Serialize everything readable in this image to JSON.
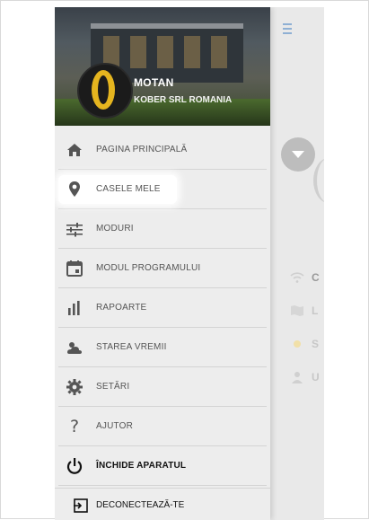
{
  "drawer": {
    "brand": "MOTAN",
    "company": "KOBER SRL ROMANIA",
    "items": [
      {
        "label": "PAGINA PRINCIPALĂ",
        "icon": "home-icon"
      },
      {
        "label": "CASELE MELE",
        "icon": "location-pin-icon"
      },
      {
        "label": "MODURI",
        "icon": "sliders-icon"
      },
      {
        "label": "MODUL PROGRAMULUI",
        "icon": "calendar-icon"
      },
      {
        "label": "RAPOARTE",
        "icon": "bar-chart-icon"
      },
      {
        "label": "STAREA VREMII",
        "icon": "weather-icon"
      },
      {
        "label": "SETĂRI",
        "icon": "gear-icon"
      },
      {
        "label": "AJUTOR",
        "icon": "question-icon"
      },
      {
        "label": "ÎNCHIDE APARATUL",
        "icon": "power-icon"
      }
    ],
    "logout": {
      "label": "DECONECTEAZĂ-TE",
      "icon": "logout-icon"
    }
  },
  "background": {
    "rows": [
      {
        "text": "C",
        "icon": "wifi-icon"
      },
      {
        "text": "L",
        "icon": "map-icon"
      },
      {
        "text": "S",
        "icon": "sun-icon"
      },
      {
        "text": "U",
        "icon": "user-icon"
      }
    ]
  },
  "colors": {
    "accent": "#e5b51f",
    "highlight": "#ffffff"
  }
}
